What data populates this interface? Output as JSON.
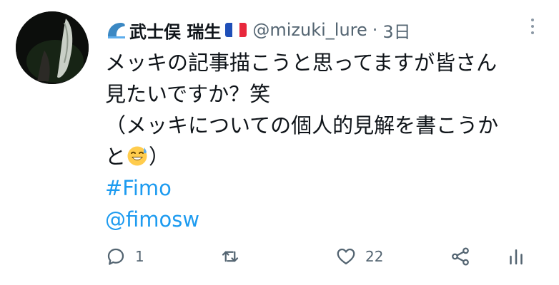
{
  "user": {
    "display_name": "武士俣 瑞生",
    "handle": "@mizuki_lure",
    "separator": "·",
    "time": "3日",
    "name_emoji": "wave-icon",
    "flag_emoji": "france-flag-icon",
    "flag_colors": [
      "#1f4fb8",
      "#ffffff",
      "#e8283c"
    ]
  },
  "tweet": {
    "lines": [
      "メッキの記事描こうと思ってますが皆さん",
      "見たいですか？笑",
      "（メッキについての個人的見解を書こうか",
      "と"
    ],
    "line4_end": "）",
    "emoji": "grinning-sweat-emoji-icon",
    "hashtag": "#Fimo",
    "mention": "@fimosw"
  },
  "actions": {
    "reply_count": "1",
    "retweet_count": "",
    "like_count": "22"
  },
  "colors": {
    "link": "#1d9bf0",
    "secondary_text": "#536471",
    "icon": "#536471"
  }
}
